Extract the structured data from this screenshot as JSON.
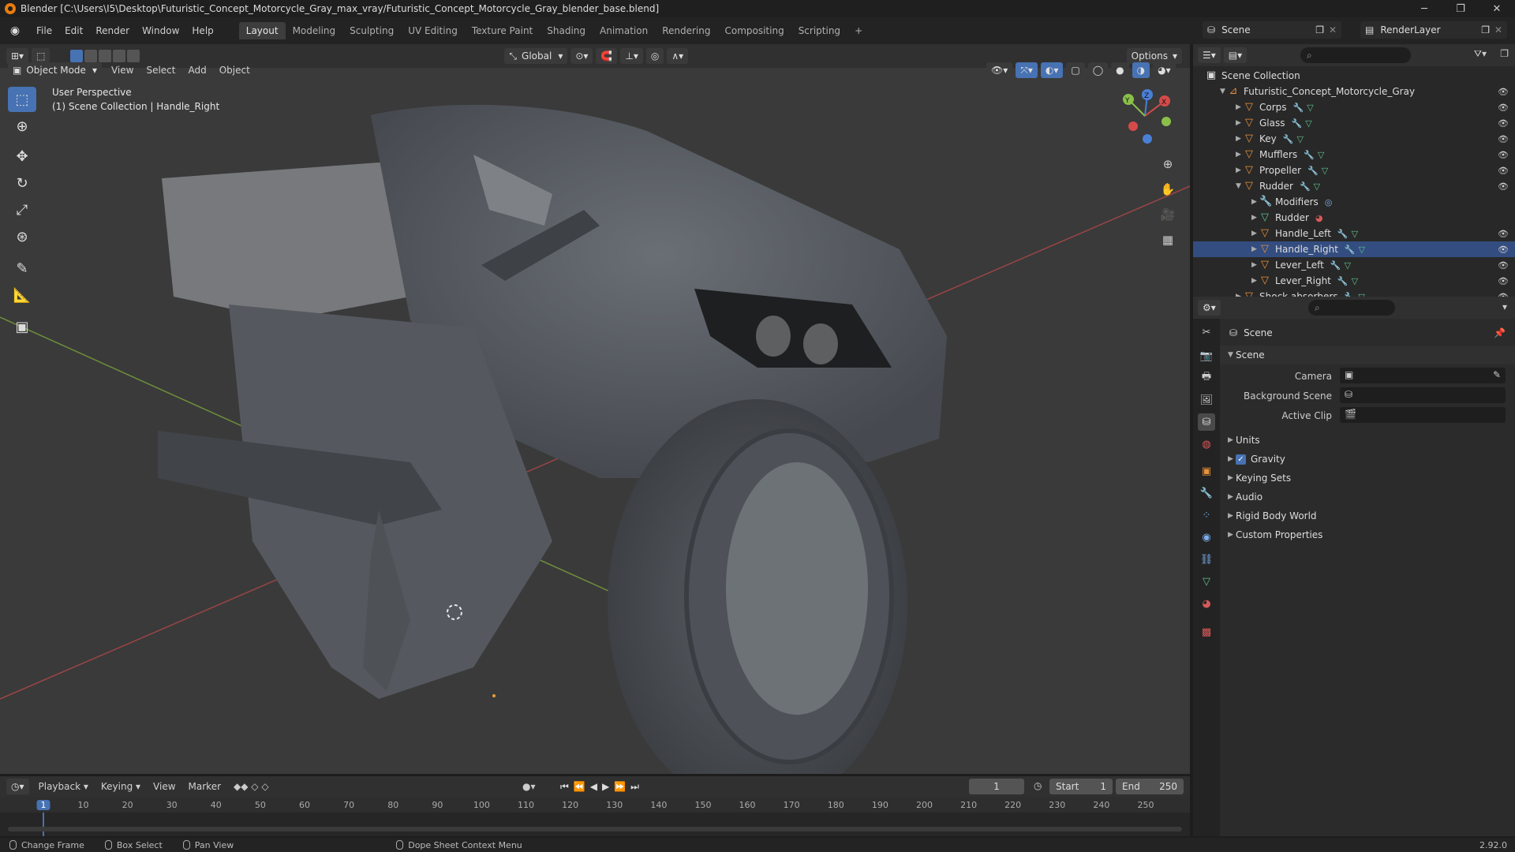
{
  "titlebar": {
    "title": "Blender [C:\\Users\\I5\\Desktop\\Futuristic_Concept_Motorcycle_Gray_max_vray/Futuristic_Concept_Motorcycle_Gray_blender_base.blend]",
    "minimize": "─",
    "maximize": "❐",
    "close": "✕"
  },
  "menu": {
    "items": [
      "File",
      "Edit",
      "Render",
      "Window",
      "Help"
    ]
  },
  "workspaces": [
    "Layout",
    "Modeling",
    "Sculpting",
    "UV Editing",
    "Texture Paint",
    "Shading",
    "Animation",
    "Rendering",
    "Compositing",
    "Scripting",
    "+"
  ],
  "scene_selector": {
    "value": "Scene"
  },
  "renderlayer_selector": {
    "value": "RenderLayer"
  },
  "toolheader": {
    "orientation": "Global",
    "options": "Options"
  },
  "viewport_header": {
    "mode": "Object Mode",
    "menus": [
      "View",
      "Select",
      "Add",
      "Object"
    ]
  },
  "viewport": {
    "perspective_label": "User Perspective",
    "collection_label": "(1) Scene Collection | Handle_Right"
  },
  "gizmo": {
    "z": "Z",
    "y": "Y",
    "x": "X"
  },
  "outliner": {
    "root": "Scene Collection",
    "rows": [
      {
        "label": "Futuristic_Concept_Motorcycle_Gray",
        "level": 1,
        "expanded": true,
        "type": "collection"
      },
      {
        "label": "Corps",
        "level": 2,
        "type": "object"
      },
      {
        "label": "Glass",
        "level": 2,
        "type": "object"
      },
      {
        "label": "Key",
        "level": 2,
        "type": "object"
      },
      {
        "label": "Mufflers",
        "level": 2,
        "type": "object"
      },
      {
        "label": "Propeller",
        "level": 2,
        "type": "object"
      },
      {
        "label": "Rudder",
        "level": 2,
        "expanded": true,
        "type": "object"
      },
      {
        "label": "Modifiers",
        "level": 3,
        "type": "modifiers"
      },
      {
        "label": "Rudder",
        "level": 3,
        "type": "mesh"
      },
      {
        "label": "Handle_Left",
        "level": 3,
        "type": "object"
      },
      {
        "label": "Handle_Right",
        "level": 3,
        "type": "object",
        "selected": true
      },
      {
        "label": "Lever_Left",
        "level": 3,
        "type": "object"
      },
      {
        "label": "Lever_Right",
        "level": 3,
        "type": "object"
      },
      {
        "label": "Shock absorbers",
        "level": 2,
        "type": "object"
      }
    ]
  },
  "properties": {
    "context": "Scene",
    "section": "Scene",
    "fields": [
      {
        "label": "Camera",
        "value": ""
      },
      {
        "label": "Background Scene",
        "value": ""
      },
      {
        "label": "Active Clip",
        "value": ""
      }
    ],
    "panels": [
      "Units",
      "Gravity",
      "Keying Sets",
      "Audio",
      "Rigid Body World",
      "Custom Properties"
    ],
    "gravity_checked": true
  },
  "timeline": {
    "menus": [
      "Playback",
      "Keying",
      "View",
      "Marker"
    ],
    "current_frame": "1",
    "start_label": "Start",
    "start": "1",
    "end_label": "End",
    "end": "250",
    "ticks": [
      "1",
      "10",
      "20",
      "30",
      "40",
      "50",
      "60",
      "70",
      "80",
      "90",
      "100",
      "110",
      "120",
      "130",
      "140",
      "150",
      "160",
      "170",
      "180",
      "190",
      "200",
      "210",
      "220",
      "230",
      "240",
      "250"
    ]
  },
  "statusbar": {
    "items": [
      "Change Frame",
      "Box Select",
      "Pan View",
      "Dope Sheet Context Menu"
    ],
    "version": "2.92.0"
  },
  "colors": {
    "accent": "#4772b3",
    "selection": "#334d80",
    "object_orange": "#e9913b"
  }
}
